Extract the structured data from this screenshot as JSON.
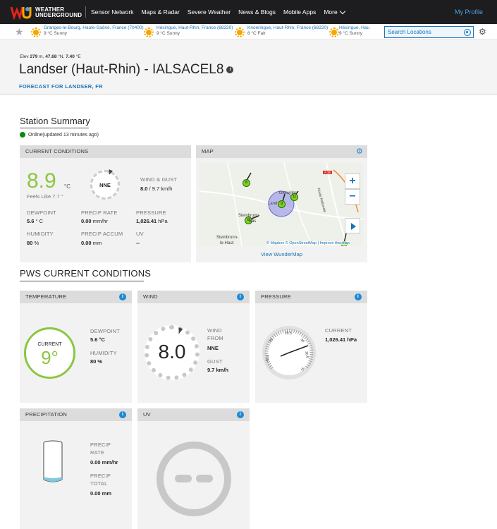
{
  "nav": {
    "logo_line1": "WEATHER",
    "logo_line2": "UNDERGROUND",
    "links": [
      "Sensor Network",
      "Maps & Radar",
      "Severe Weather",
      "News & Blogs",
      "Mobile Apps"
    ],
    "more": "More",
    "profile": "My Profile"
  },
  "favorites": [
    {
      "location": "Granges-le-Bourg, Haute-Saône, France (70400)",
      "weather": "9 °C Sunny"
    },
    {
      "location": "Hésingue, Haut-Rhin, France (68220)",
      "weather": "9 °C Sunny"
    },
    {
      "location": "Knoeringue, Haut-Rhin, France (68220)",
      "weather": "8 °C Fair"
    },
    {
      "location": "Hésingue, Hau",
      "weather": "9 °C Sunny"
    }
  ],
  "search": {
    "placeholder": "Search Locations"
  },
  "header": {
    "elev_label": "Elev",
    "elev_value": "279",
    "elev_unit": "m,",
    "lat_value": "47.68",
    "lat_unit": "°N,",
    "lon_value": "7.40",
    "lon_unit": "°E",
    "title": "Landser (Haut-Rhin) - IALSACEL8",
    "forecast_link": "FORECAST FOR LANDSER, FR"
  },
  "summary": {
    "title": "Station Summary",
    "status": "Online(updated 13 minutes ago)"
  },
  "current": {
    "heading": "CURRENT CONDITIONS",
    "temp": "8.9",
    "temp_unit": "°C",
    "feels_like": "Feels Like 7.7 °",
    "wind_dir": "NNE",
    "wind_gust_label": "WIND & GUST",
    "wind_speed": "8.0",
    "wind_gust": "/ 9.7 km/h",
    "dewpoint_label": "DEWPOINT",
    "dewpoint_value": "5.6",
    "dewpoint_unit": "° C",
    "precip_rate_label": "PRECIP RATE",
    "precip_rate_value": "0.00",
    "precip_rate_unit": "mm/hr",
    "pressure_label": "PRESSURE",
    "pressure_value": "1,026.41",
    "pressure_unit": "hPa",
    "humidity_label": "HUMIDITY",
    "humidity_value": "80",
    "humidity_unit": "%",
    "precip_accum_label": "PRECIP ACCUM",
    "precip_accum_value": "0.00",
    "precip_accum_unit": "mm",
    "uv_label": "UV",
    "uv_value": "--"
  },
  "map": {
    "heading": "MAP",
    "view_link": "View WunderMap",
    "attribution_mapbox": "© Mapbox",
    "attribution_osm": "© OpenStreetMap",
    "improve": "Improve this map",
    "place_landser": "Land",
    "place_dietwiller": "Dietwiller",
    "place_steinbrunn_bas": "Steinbrunn-",
    "place_steinbrunn_bas2": "Bas",
    "place_steinbrunn_haut": "Steinbrunn-",
    "place_steinbrunn_haut2": "le-Haut",
    "road": "Route Nationale",
    "road_badge": "A 35",
    "markers": [
      "8",
      "9",
      "11",
      "8"
    ]
  },
  "pws": {
    "title": "PWS CURRENT CONDITIONS",
    "temperature": {
      "heading": "TEMPERATURE",
      "current_label": "CURRENT",
      "current_value": "9°",
      "dewpoint_label": "DEWPOINT",
      "dewpoint_value": "5.6 °C",
      "humidity_label": "HUMIDITY",
      "humidity_value": "80 %"
    },
    "wind": {
      "heading": "WIND",
      "speed": "8.0",
      "from_label1": "WIND",
      "from_label2": "FROM",
      "from_value": "NNE",
      "gust_label": "GUST",
      "gust_value": "9.7 km/h"
    },
    "pressure": {
      "heading": "PRESSURE",
      "current_label": "CURRENT",
      "current_value": "1,026.41 hPa",
      "gauge_ticks": [
        "28.5",
        "29",
        "29.5",
        "30",
        "30.5",
        "31"
      ]
    },
    "precipitation": {
      "heading": "PRECIPITATION",
      "rate_label1": "PRECIP",
      "rate_label2": "RATE",
      "rate_value": "0.00 mm/hr",
      "total_label1": "PRECIP",
      "total_label2": "TOTAL",
      "total_value": "0.00 mm"
    },
    "uv": {
      "heading": "UV"
    }
  },
  "colors": {
    "accent": "#1a74b8",
    "temp_green": "#8cc63f",
    "online_green": "#0a8a0a",
    "nav_bg": "#1d1d1f"
  }
}
